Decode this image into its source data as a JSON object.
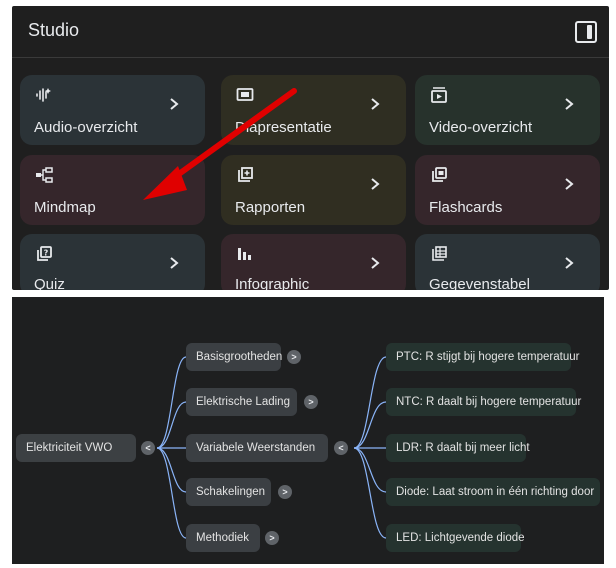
{
  "studio": {
    "title": "Studio",
    "tiles": [
      {
        "label": "Audio-overzicht",
        "icon": "audio-waveform-icon",
        "bg": "#2b3337"
      },
      {
        "label": "Diapresentatie",
        "icon": "slides-icon",
        "bg": "#2f2e22"
      },
      {
        "label": "Video-overzicht",
        "icon": "video-icon",
        "bg": "#27322c"
      },
      {
        "label": "Mindmap",
        "icon": "mindmap-icon",
        "bg": "#35262b"
      },
      {
        "label": "Rapporten",
        "icon": "report-icon",
        "bg": "#302e21"
      },
      {
        "label": "Flashcards",
        "icon": "flashcards-icon",
        "bg": "#35262b"
      },
      {
        "label": "Quiz",
        "icon": "quiz-icon",
        "bg": "#2b3337"
      },
      {
        "label": "Infographic",
        "icon": "infographic-icon",
        "bg": "#35262b"
      },
      {
        "label": "Gegevenstabel",
        "icon": "data-table-icon",
        "bg": "#2b3337"
      }
    ]
  },
  "mindmap": {
    "root": "Elektriciteit VWO",
    "branches": [
      "Basisgrootheden",
      "Elektrische Lading",
      "Variabele Weerstanden",
      "Schakelingen",
      "Methodiek"
    ],
    "leaves": [
      "PTC: R stijgt bij hogere temperatuur",
      "NTC: R daalt bij hogere temperatuur",
      "LDR: R daalt bij meer licht",
      "Diode: Laat stroom in één richting door",
      "LED: Lichtgevende diode"
    ],
    "expand_glyph": ">",
    "collapse_glyph": "<"
  },
  "colors": {
    "arrow": "#e00000",
    "connector": "#8ab4f8"
  }
}
